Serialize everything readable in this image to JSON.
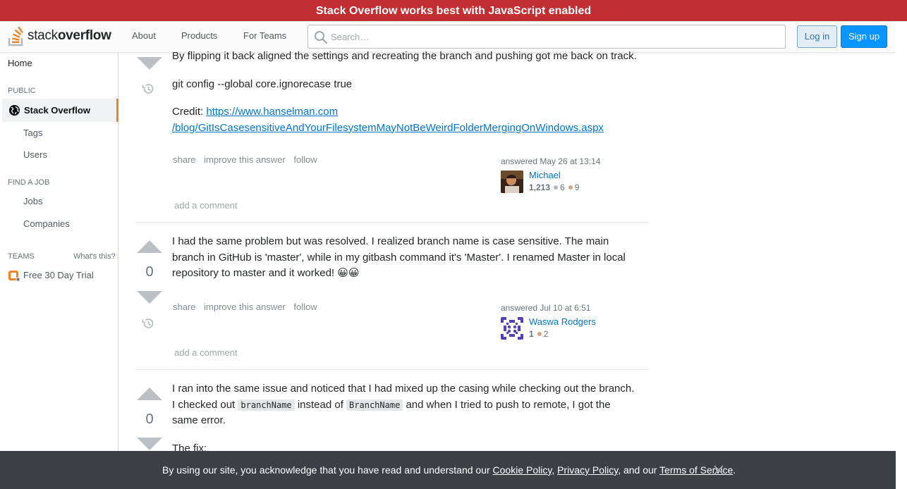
{
  "banner": {
    "text": "Stack Overflow works best with JavaScript enabled"
  },
  "header": {
    "logo_text_regular": "stack",
    "logo_text_bold": "overflow",
    "nav": [
      "About",
      "Products",
      "For Teams"
    ],
    "search_placeholder": "Search…",
    "login_label": "Log in",
    "signup_label": "Sign up"
  },
  "sidebar": {
    "home": "Home",
    "public_heading": "PUBLIC",
    "active_item": "Stack Overflow",
    "public_items": [
      "Tags",
      "Users"
    ],
    "job_heading": "FIND A JOB",
    "job_items": [
      "Jobs",
      "Companies"
    ],
    "teams_heading": "TEAMS",
    "whats_this": "What's this?",
    "trial": "Free 30 Day Trial"
  },
  "answers": [
    {
      "vote_count": "",
      "paragraphs": [
        "By flipping it back aligned the settings and recreating the branch and pushing got me back on track.",
        "git config --global core.ignorecase true"
      ],
      "credit_label": "Credit: ",
      "credit_link_1": "https://www.hanselman.com",
      "credit_link_2": "/blog/GitIsCasesensitiveAndYourFilesystemMayNotBeWeirdFolderMergingOnWindows.aspx",
      "menu": [
        "share",
        "improve this answer",
        "follow"
      ],
      "answered": "answered May 26 at 13:14",
      "user": "Michael",
      "reputation": "1,213",
      "silver": "6",
      "bronze": "9",
      "add_comment": "add a comment"
    },
    {
      "vote_count": "0",
      "text_before_emoji": "I had the same problem but was resolved. I realized branch name is case sensitive. The main branch in GitHub is 'master', while in my gitbash command it's 'Master'. I renamed Master in local repository to master and it worked! ",
      "emoji": "😀😀",
      "menu": [
        "share",
        "improve this answer",
        "follow"
      ],
      "answered": "answered Jul 10 at 6:51",
      "user": "Waswa Rodgers",
      "reputation": "1",
      "bronze": "2",
      "add_comment": "add a comment"
    },
    {
      "vote_count": "0",
      "text_1": "I ran into the same issue and noticed that I had mixed up the casing while checking out the branch. I checked out ",
      "code_1": "branchName",
      "text_2": " instead of ",
      "code_2": "BranchName",
      "text_3": " and when I tried to push to remote, I got the same error.",
      "text_4": "The fix:"
    }
  ],
  "cookie": {
    "prefix": "By using our site, you acknowledge that you have read and understand our ",
    "cookie_policy": "Cookie Policy",
    "sep1": ", ",
    "privacy_policy": "Privacy Policy",
    "sep2": ", and our ",
    "terms": "Terms of Service",
    "suffix": "."
  },
  "colors": {
    "banner": "#c22e32",
    "accent": "#f48024",
    "link": "#0077cc",
    "signup": "#0a95ff",
    "cookie_bg": "#3b4045"
  }
}
